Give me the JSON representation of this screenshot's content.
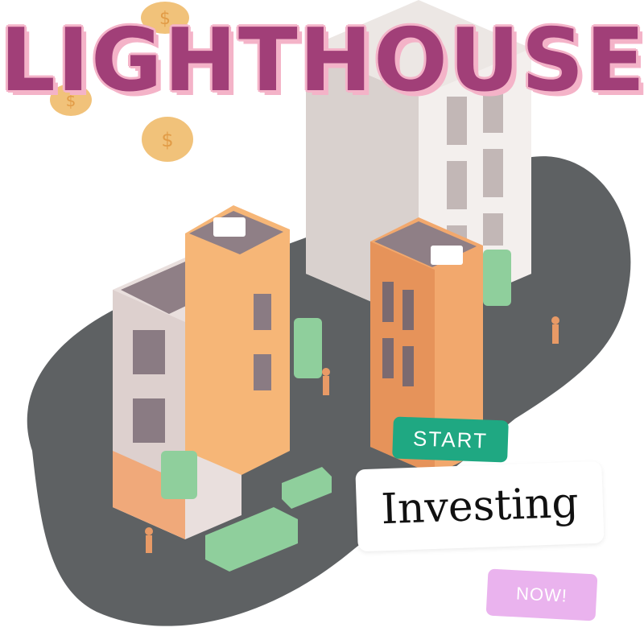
{
  "title": "LIGHTHOUSE",
  "start_label": "START",
  "investing_label": "Investing",
  "now_label": "NOW!",
  "colors": {
    "title_fill": "#a13f78",
    "title_outline": "#f4b3c8",
    "road": "#5e6163",
    "start_bg": "#1fa882",
    "now_bg": "#eab3ee",
    "coin": "#f1c27a"
  },
  "icons": [
    "dollar-coin-icon",
    "air-conditioner-icon"
  ]
}
